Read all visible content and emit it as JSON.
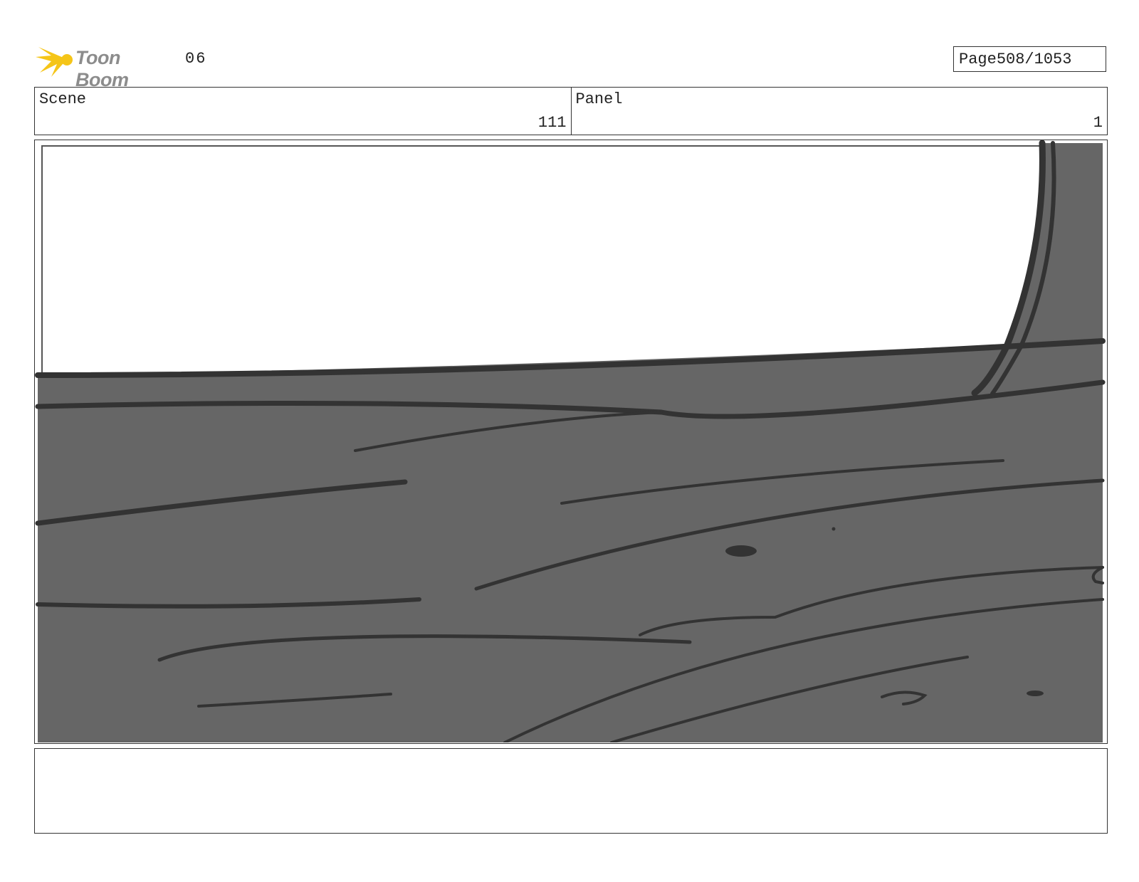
{
  "header": {
    "logo_text": "Toon Boom",
    "episode": "06",
    "page_label": "Page",
    "page_number": "508/1053"
  },
  "info": {
    "scene_label": "Scene",
    "scene_value": "111",
    "panel_label": "Panel",
    "panel_value": "1"
  },
  "colors": {
    "logo_star": "#f5c518",
    "ground_fill": "#666666",
    "stroke": "#333333"
  },
  "notes": {
    "text": ""
  }
}
